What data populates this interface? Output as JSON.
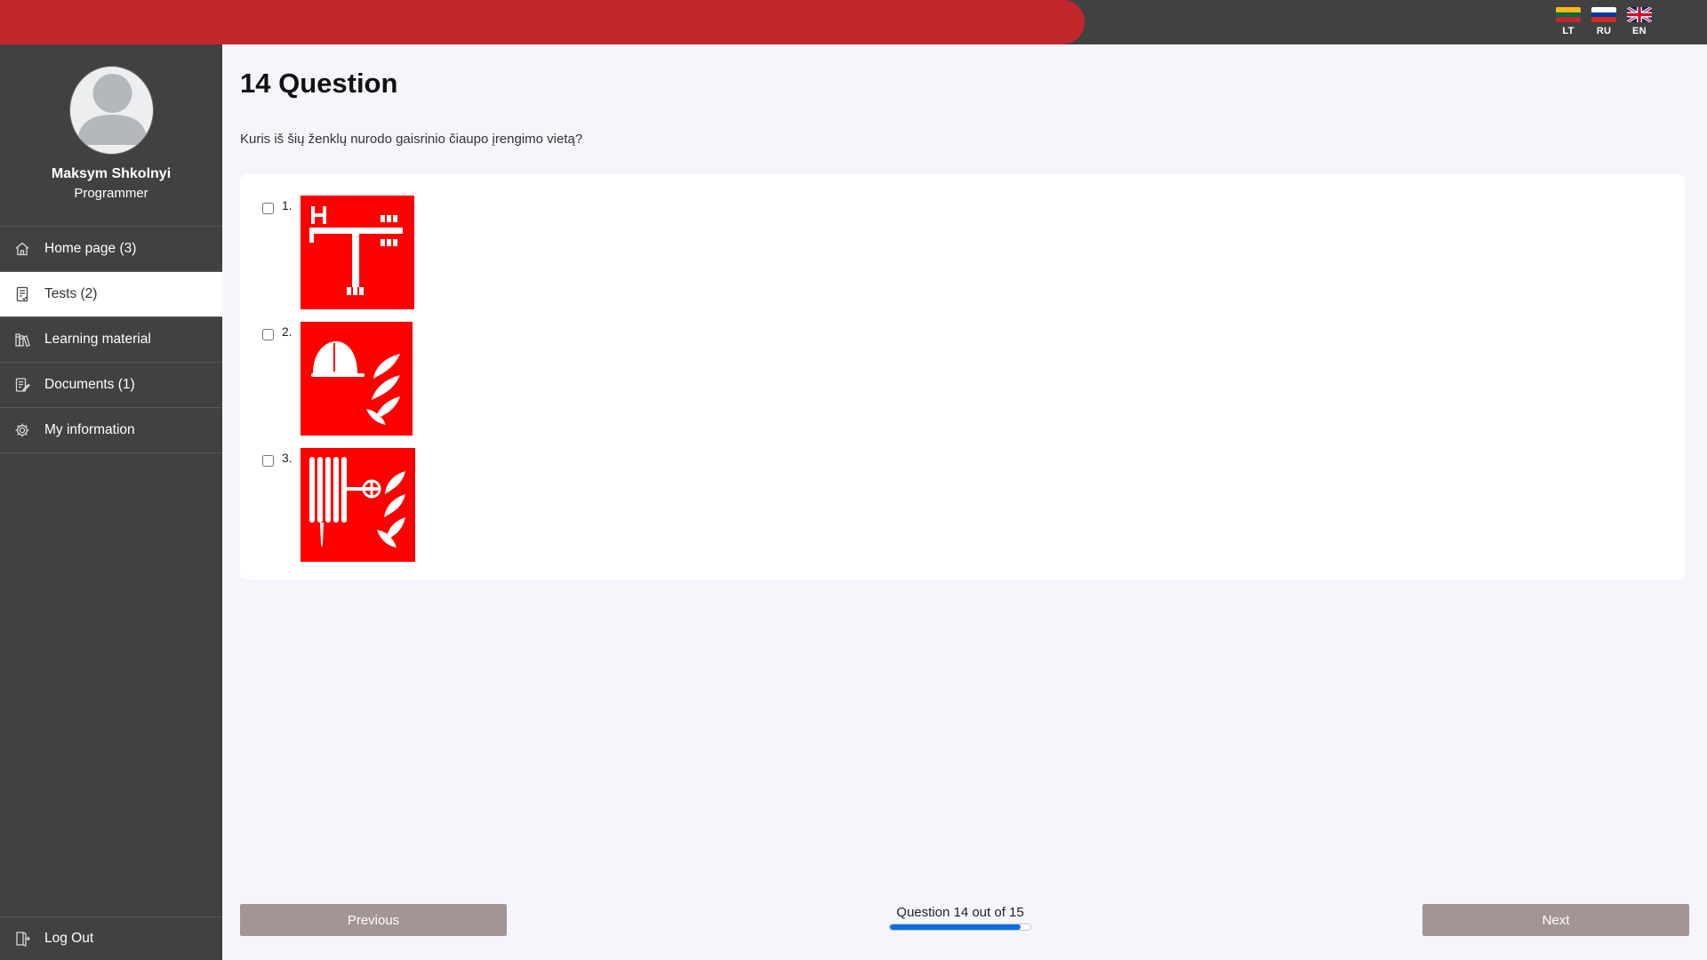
{
  "languages": [
    {
      "code": "LT",
      "icon": "lithuania-flag-icon"
    },
    {
      "code": "RU",
      "icon": "russia-flag-icon"
    },
    {
      "code": "EN",
      "icon": "uk-flag-icon"
    }
  ],
  "user": {
    "name": "Maksym Shkolnyi",
    "role": "Programmer",
    "avatar_icon": "user-avatar-icon"
  },
  "nav": {
    "items": [
      {
        "label": "Home page (3)",
        "icon": "home-icon"
      },
      {
        "label": "Tests (2)",
        "icon": "test-document-icon",
        "active": true
      },
      {
        "label": "Learning material",
        "icon": "books-icon"
      },
      {
        "label": "Documents (1)",
        "icon": "document-edit-icon"
      },
      {
        "label": "My information",
        "icon": "gear-icon"
      }
    ],
    "logout_label": "Log Out",
    "logout_icon": "logout-icon"
  },
  "question": {
    "title": "14 Question",
    "text": "Kuris iš šių ženklų nurodo gaisrinio čiaupo įrengimo vietą?",
    "answers": [
      {
        "number": "1.",
        "checked": false,
        "icon": "fire-hydrant-sign-icon"
      },
      {
        "number": "2.",
        "checked": false,
        "icon": "firefighter-helmet-fire-sign-icon"
      },
      {
        "number": "3.",
        "checked": false,
        "icon": "fire-hose-reel-sign-icon"
      }
    ]
  },
  "footer": {
    "previous_label": "Previous",
    "next_label": "Next",
    "progress_label": "Question 14 out of 15",
    "progress_fraction": 0.933
  },
  "colors": {
    "topbar_red": "#c1272d",
    "dark": "#414141",
    "sign_red": "#ff0000",
    "button": "#a39594",
    "progress": "#0a6ee0"
  }
}
